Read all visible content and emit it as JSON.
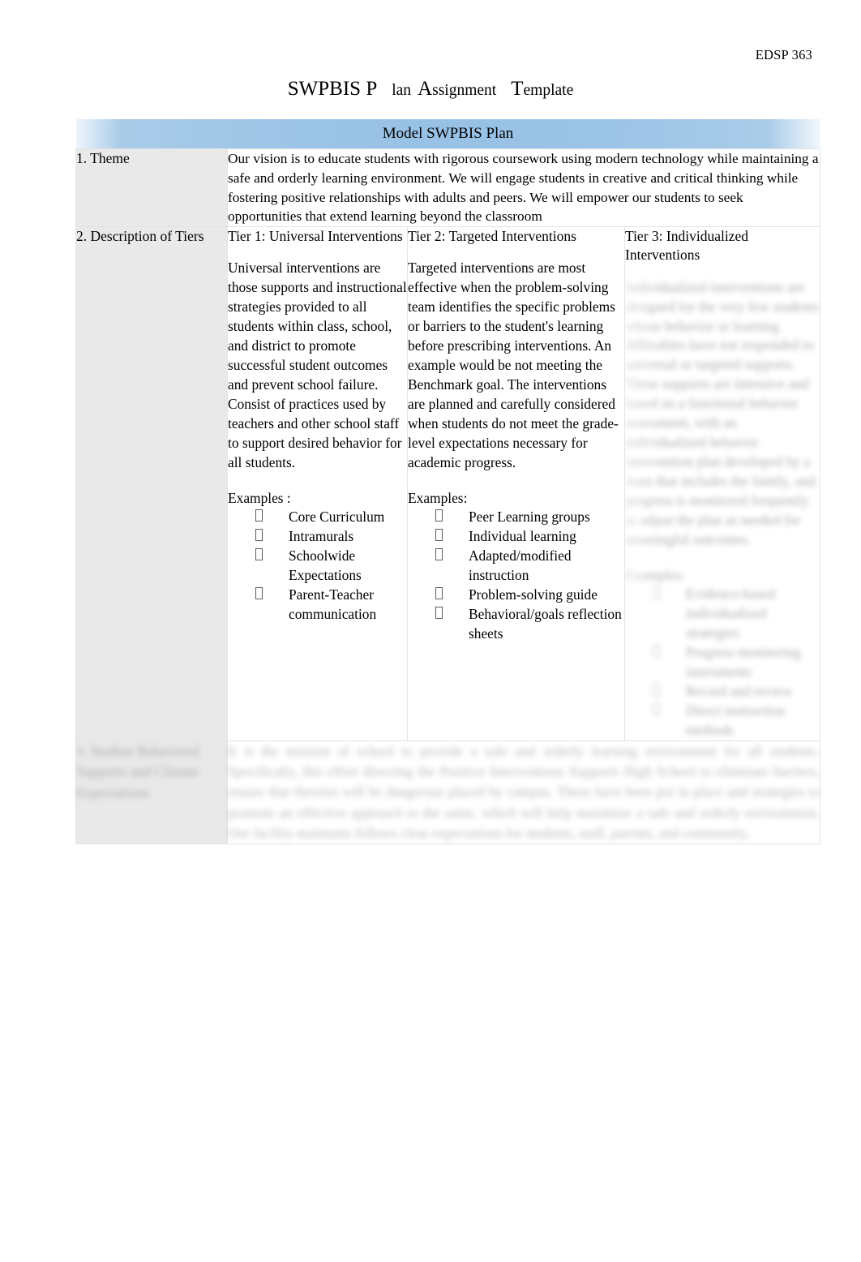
{
  "header": {
    "course_code": "EDSP 363"
  },
  "title": {
    "part1_cap": "SWPBIS P",
    "part1_sc": "lan",
    "part2_cap": "A",
    "part2_sc": "ssignment",
    "part3_cap": "T",
    "part3_sc": "emplate",
    "full_text": "SWPBIS Plan Assignment Template"
  },
  "table": {
    "banner": "Model SWPBIS Plan",
    "banner_color": "#9cc4e6",
    "label_shade_color": "#e9e9e9",
    "rows": {
      "theme": {
        "label": "1. Theme",
        "label_number": "1.",
        "label_text": "Theme",
        "text": "Our vision is to educate students with rigorous coursework using modern technology while maintaining a safe and orderly learning environment. We will engage students in creative and critical thinking while fostering positive relationships with adults and peers. We will empower our students to seek opportunities that extend learning beyond the classroom"
      },
      "tiers": {
        "label_number": "2.",
        "label_text": "Description of Tiers",
        "label": "2. Description of Tiers",
        "columns": [
          {
            "heading": "Tier 1: Universal Interventions",
            "body": "Universal interventions are those supports and instructional strategies provided to all students within class, school, and district to promote successful student outcomes and prevent school failure. Consist of practices used by teachers and other school staff to support desired behavior for all students.",
            "examples_label": "Examples :",
            "examples": [
              "Core Curriculum",
              "Intramurals",
              "Schoolwide Expectations",
              "Parent-Teacher communication"
            ],
            "bullet_glyph": "tofu-box"
          },
          {
            "heading": "Tier 2: Targeted Interventions",
            "body": "Targeted interventions are most effective when the problem-solving team identifies the specific problems or barriers to the student's learning before prescribing interventions. An example would be not meeting the Benchmark goal. The interventions are planned and carefully considered when students do not meet the grade-level expectations necessary for academic progress.",
            "examples_label": "Examples:",
            "examples": [
              "Peer Learning groups",
              "Individual learning",
              "Adapted/modified instruction",
              "Problem-solving guide",
              "Behavioral/goals reflection sheets"
            ],
            "bullet_glyph": "tofu-box"
          },
          {
            "heading": "Tier 3: Individualized Interventions",
            "body_status": "blurred-unreadable",
            "body_placeholder": "Individualized interventions are designed for the very few students whose behavior or learning difficulties have not responded to universal or targeted supports. These supports are intensive and based on a functional behavior assessment, with an individualized behavior intervention plan developed by a team that includes the family, and progress is monitored frequently to adjust the plan as needed for meaningful outcomes.",
            "examples_label": "Examples:",
            "examples_status": "blurred-unreadable",
            "examples_placeholder": [
              "Evidence-based individualized strategies",
              "Progress monitoring instruments",
              "Record and review",
              "Direct instruction methods"
            ],
            "bullet_glyph": "tofu-box"
          }
        ]
      },
      "last": {
        "label_status": "blurred-unreadable",
        "label_number": "3.",
        "label_placeholder": "Student Behavioral Supports and Climate Expectations",
        "body_status": "blurred-unreadable",
        "body_placeholder": "It is the mission of school to provide a safe and orderly learning environment for all students. Specifically, this effort directing the Positive Interventions Supports High School to eliminate barriers, ensure that theories will be dangerous placed by campus. These have been put in place and strategies to promote an effective approach to the same, which will help maximize a safe and orderly environment. Our facility maintains follows clear expectations for students, staff, parents, and community."
      }
    }
  }
}
